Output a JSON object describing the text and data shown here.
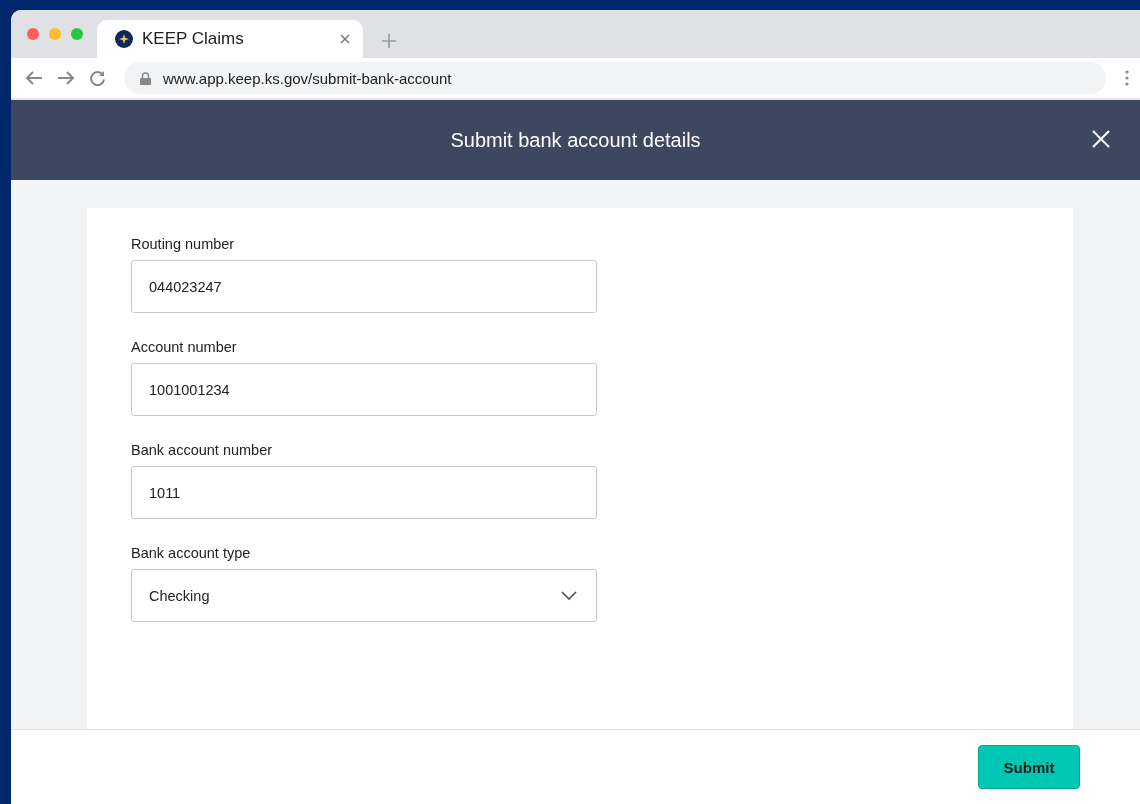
{
  "browser": {
    "tab_title": "KEEP Claims",
    "url": "www.app.keep.ks.gov/submit-bank-account"
  },
  "modal": {
    "title": "Submit bank account details"
  },
  "fields": [
    {
      "kind": "text",
      "label": "Routing number",
      "value": "044023247"
    },
    {
      "kind": "text",
      "label": "Account number",
      "value": "1001001234"
    },
    {
      "kind": "text",
      "label": "Bank account number",
      "value": "1011"
    },
    {
      "kind": "select",
      "label": "Bank account type",
      "value": "Checking"
    }
  ],
  "buttons": [
    {
      "label": "Submit"
    }
  ]
}
